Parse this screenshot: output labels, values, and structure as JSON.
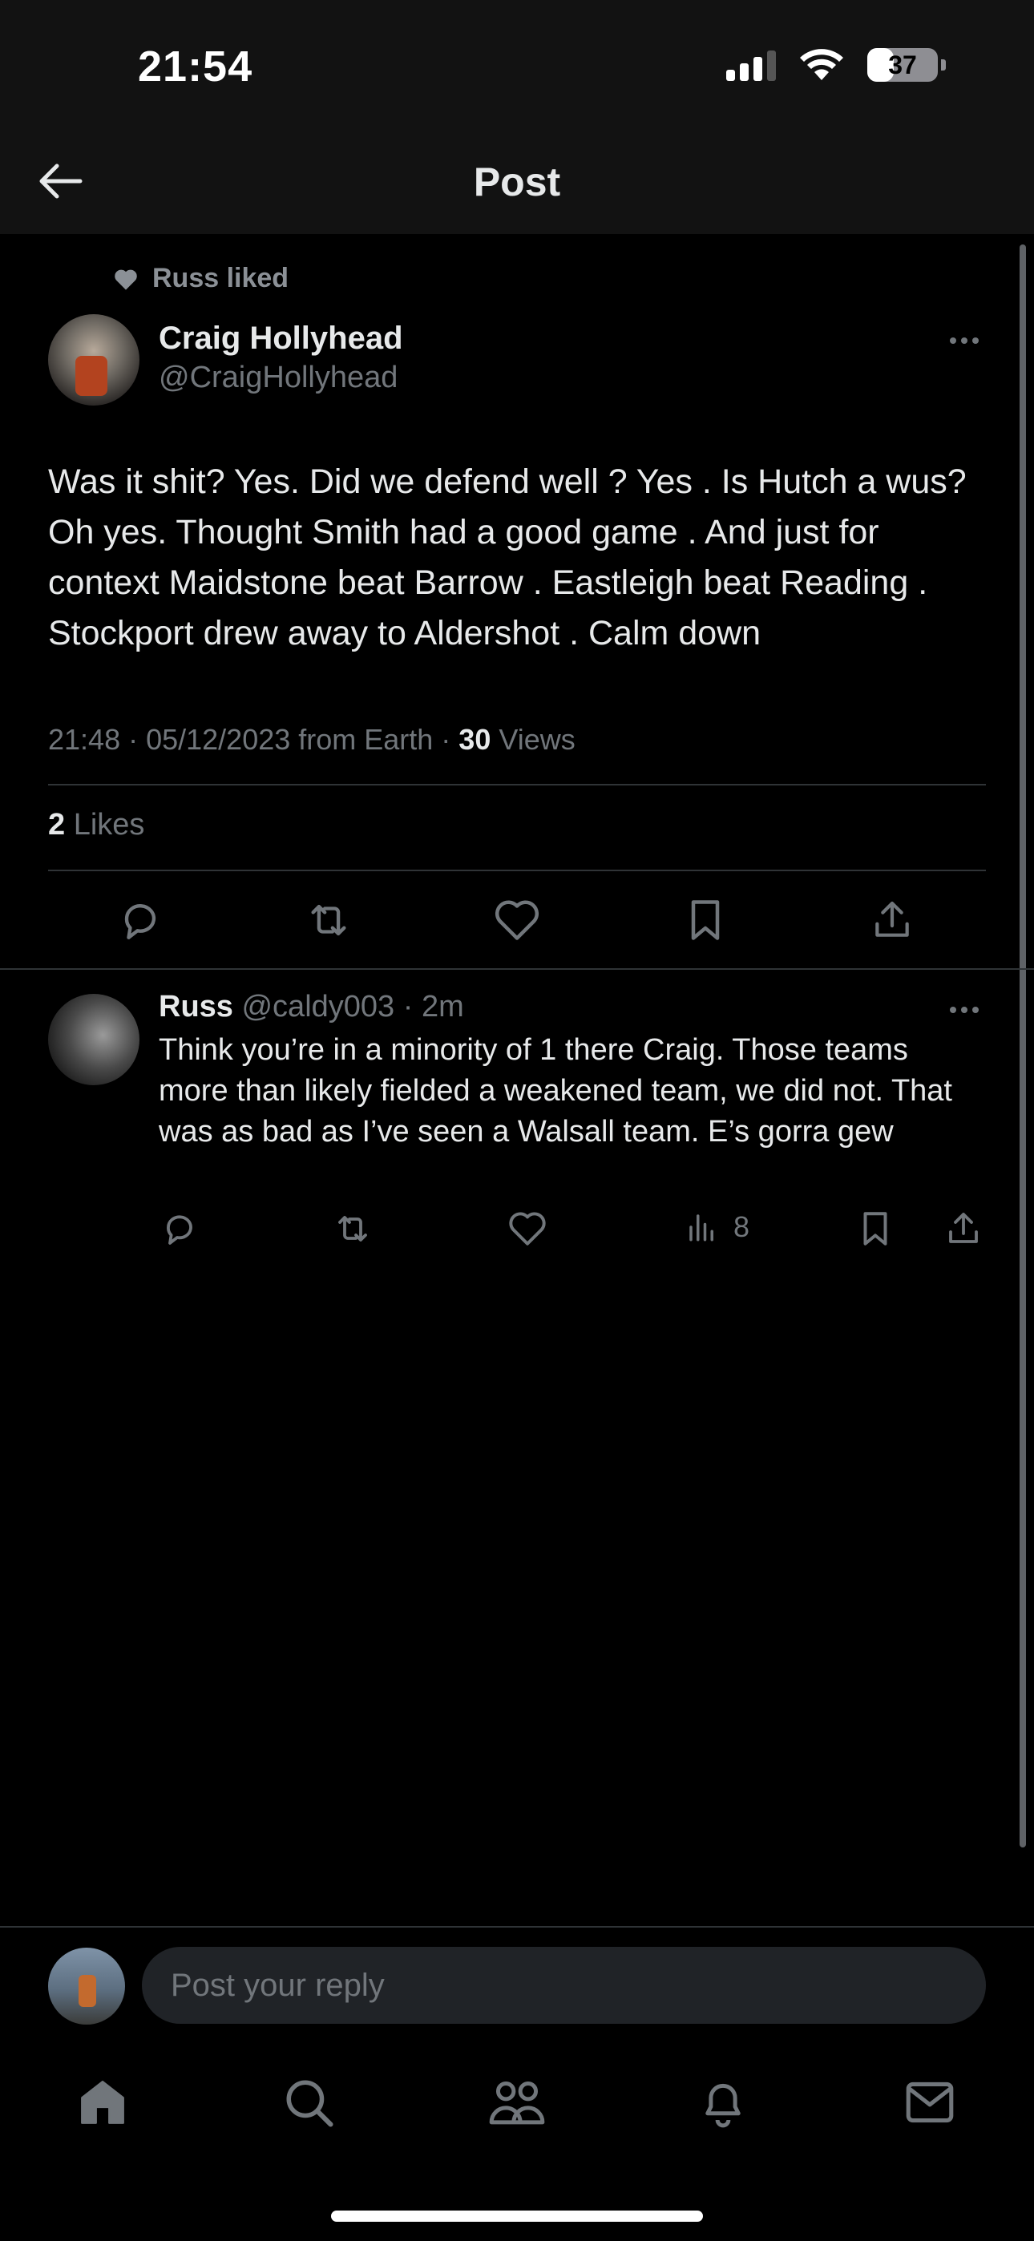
{
  "status_bar": {
    "time": "21:54",
    "battery": "37",
    "battery_level": 0.37
  },
  "header": {
    "title": "Post"
  },
  "post": {
    "social_context": "Russ liked",
    "author_name": "Craig Hollyhead",
    "author_handle": "@CraigHollyhead",
    "text": "Was it shit? Yes. Did we defend well ? Yes . Is Hutch a wus? Oh yes. Thought Smith had a good game . And just for context Maidstone beat Barrow . Eastleigh beat Reading . Stockport drew away to Aldershot . Calm down",
    "timestamp": "21:48 · 05/12/2023 from Earth · ",
    "views_count": "30",
    "views_label": " Views",
    "likes_count": "2",
    "likes_label": " Likes",
    "actions": [
      "reply-icon",
      "repost-icon",
      "like-icon",
      "bookmark-icon",
      "share-icon"
    ]
  },
  "reply": {
    "author_name": "Russ",
    "author_handle": " @caldy003",
    "time": " · 2m",
    "text": "Think you’re in a minority of 1 there Craig. Those teams more than likely fielded a weakened team, we did not. That was as bad as I’ve seen a Walsall team. E’s gorra gew",
    "views": "8",
    "actions": [
      "reply-icon",
      "repost-icon",
      "like-icon",
      "views-icon",
      "bookmark-icon",
      "share-icon"
    ]
  },
  "composer": {
    "placeholder": "Post your reply"
  },
  "bottom_nav": [
    "home-icon",
    "search-icon",
    "communities-icon",
    "notifications-icon",
    "messages-icon"
  ],
  "colors": {
    "background": "#000000",
    "header_bg": "#121212",
    "text_primary": "#e7e9ea",
    "text_secondary": "#71767b",
    "divider": "#2f3336"
  }
}
